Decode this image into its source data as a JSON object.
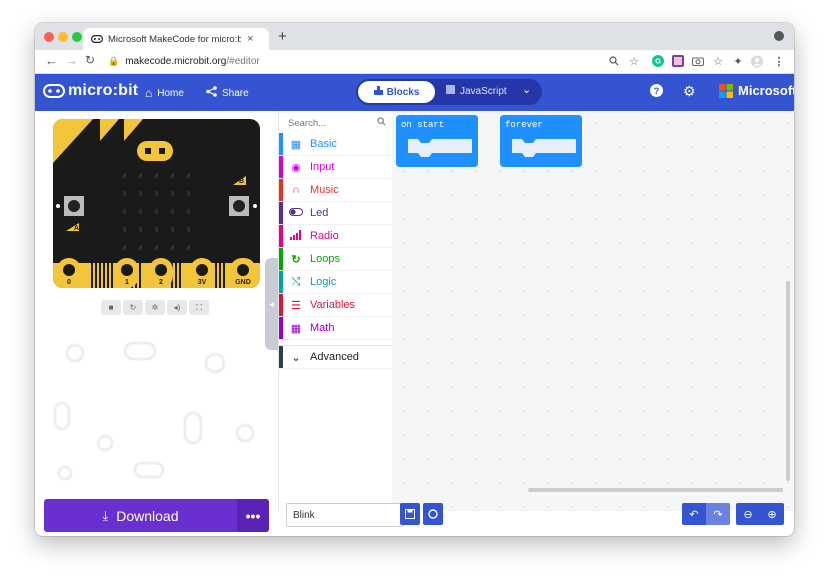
{
  "browser": {
    "tab_title": "Microsoft MakeCode for micro:bit",
    "tab_close": "×",
    "new_tab": "+",
    "url_host": "makecode.microbit.org",
    "url_path": "/#editor"
  },
  "header": {
    "logo": "micro:bit",
    "home": "Home",
    "share": "Share",
    "blocks": "Blocks",
    "javascript": "JavaScript",
    "brand": "Microsoft"
  },
  "board": {
    "pins": [
      "0",
      "1",
      "2",
      "3V",
      "GND"
    ],
    "button_a": "A",
    "button_b": "B"
  },
  "toolbox": {
    "search_placeholder": "Search...",
    "categories": [
      {
        "label": "Basic",
        "color": "#1e90ff"
      },
      {
        "label": "Input",
        "color": "#d400d4"
      },
      {
        "label": "Music",
        "color": "#e63022"
      },
      {
        "label": "Led",
        "color": "#5c2d91"
      },
      {
        "label": "Radio",
        "color": "#e3008c"
      },
      {
        "label": "Loops",
        "color": "#00aa00"
      },
      {
        "label": "Logic",
        "color": "#00a4a6"
      },
      {
        "label": "Variables",
        "color": "#dc143c"
      },
      {
        "label": "Math",
        "color": "#9400d3"
      }
    ],
    "advanced": "Advanced"
  },
  "workspace": {
    "blocks": [
      {
        "label": "on start",
        "color": "#1e90ff"
      },
      {
        "label": "forever",
        "color": "#1e90ff"
      }
    ]
  },
  "footer": {
    "download": "Download",
    "more": "•••",
    "project_name": "Blink"
  },
  "colors": {
    "primary": "#3454d1",
    "download": "#6a2fd0"
  }
}
